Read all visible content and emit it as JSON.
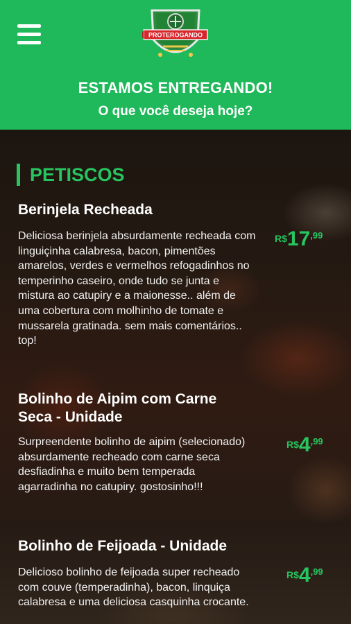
{
  "header": {
    "logo_text": "PROTEROGANDO",
    "headline": "ESTAMOS ENTREGANDO!",
    "subline": "O que você deseja hoje?"
  },
  "section": {
    "title": "PETISCOS"
  },
  "items": [
    {
      "name": "Berinjela Recheada",
      "description": "Deliciosa berinjela absurdamente recheada com linguiçinha calabresa, bacon, pimentões amarelos, verdes e vermelhos refogadinhos no temperinho caseiro, onde tudo se junta e mistura ao catupiry e a maionesse.. além de uma cobertura com molhinho de tomate e mussarela gratinada. sem mais comentários.. top!",
      "price": {
        "currency": "R$",
        "integer": "17",
        "cents": ",99"
      }
    },
    {
      "name": "Bolinho de Aipim com Carne Seca - Unidade",
      "description": "Surpreendente bolinho de aipim (selecionado) absurdamente recheado com carne seca desfiadinha e muito bem temperada agarradinha no catupiry. gostosinho!!!",
      "price": {
        "currency": "R$",
        "integer": "4",
        "cents": ",99"
      }
    },
    {
      "name": "Bolinho de Feijoada - Unidade",
      "description": "Delicioso bolinho de feijoada super recheado com couve (temperadinha), bacon, linquiça calabresa e uma deliciosa casquinha crocante.",
      "price": {
        "currency": "R$",
        "integer": "4",
        "cents": ",99"
      }
    }
  ],
  "colors": {
    "brand_green": "#1fb85a",
    "accent_green": "#27c45f"
  }
}
